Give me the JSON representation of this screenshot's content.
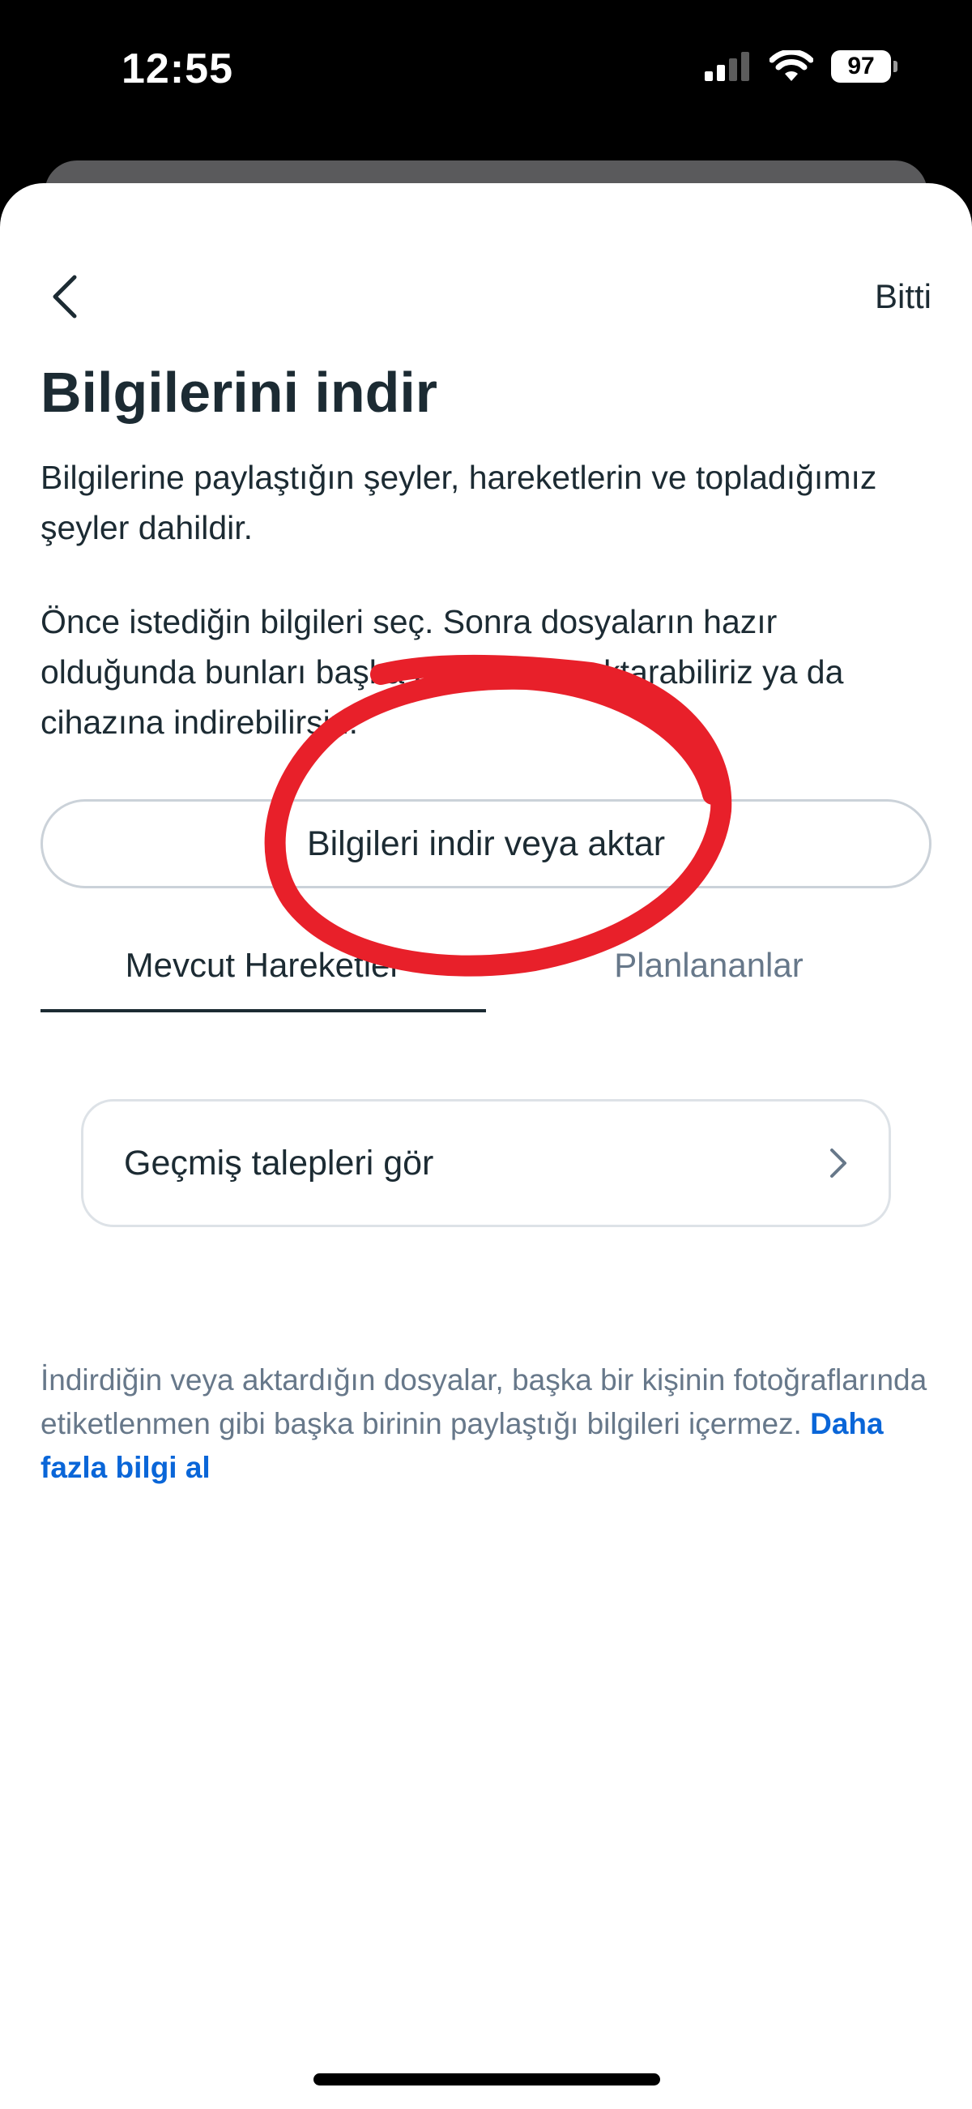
{
  "status_bar": {
    "time": "12:55",
    "battery": "97",
    "icons": [
      "signal-icon",
      "wifi-icon",
      "battery-icon"
    ]
  },
  "nav": {
    "back_icon": "chevron-left-icon",
    "done_label": "Bitti"
  },
  "page": {
    "title": "Bilgilerini indir",
    "description_1": "Bilgilerine paylaştığın şeyler, hareketlerin ve topladığımız şeyler dahildir.",
    "description_2": "Önce istediğin bilgileri seç. Sonra dosyaların hazır olduğunda bunları başka bir hizmete aktarabiliriz ya da cihazına indirebilirsin.",
    "primary_button": "Bilgileri indir veya aktar"
  },
  "tabs": [
    {
      "label": "Mevcut Hareketler",
      "active": true
    },
    {
      "label": "Planlananlar",
      "active": false
    }
  ],
  "history": {
    "label": "Geçmiş talepleri gör",
    "icon": "chevron-right-icon"
  },
  "footer": {
    "note": "İndirdiğin veya aktardığın dosyalar, başka bir kişinin fotoğraflarında etiketlenmen gibi başka birinin paylaştığı bilgileri içermez. ",
    "link": "Daha fazla bilgi al"
  },
  "colors": {
    "text_primary": "#1c2b33",
    "text_secondary": "#67788a",
    "link": "#0a66d8",
    "annotation": "#e8202a"
  }
}
